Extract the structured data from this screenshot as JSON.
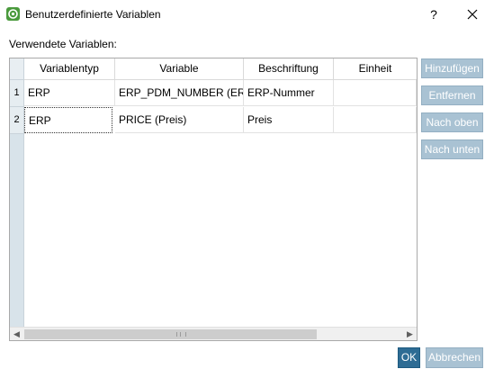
{
  "window": {
    "title": "Benutzerdefinierte Variablen",
    "help_label": "?",
    "close_label": "✕"
  },
  "section_label": "Verwendete Variablen:",
  "table": {
    "columns": [
      "Variablentyp",
      "Variable",
      "Beschriftung",
      "Einheit"
    ],
    "rows": [
      {
        "num": "1",
        "cells": [
          "ERP",
          "ERP_PDM_NUMBER (ER…",
          "ERP-Nummer",
          ""
        ]
      },
      {
        "num": "2",
        "cells": [
          "ERP",
          "PRICE (Preis)",
          "Preis",
          ""
        ]
      }
    ]
  },
  "side_buttons": {
    "add": "Hinzufügen",
    "remove": "Entfernen",
    "up": "Nach oben",
    "down": "Nach unten"
  },
  "footer": {
    "ok": "OK",
    "cancel": "Abbrechen"
  },
  "colors": {
    "accent": "#2e6c94",
    "disabled_button": "#a9c2d3",
    "app_icon": "#4a9a3c"
  }
}
